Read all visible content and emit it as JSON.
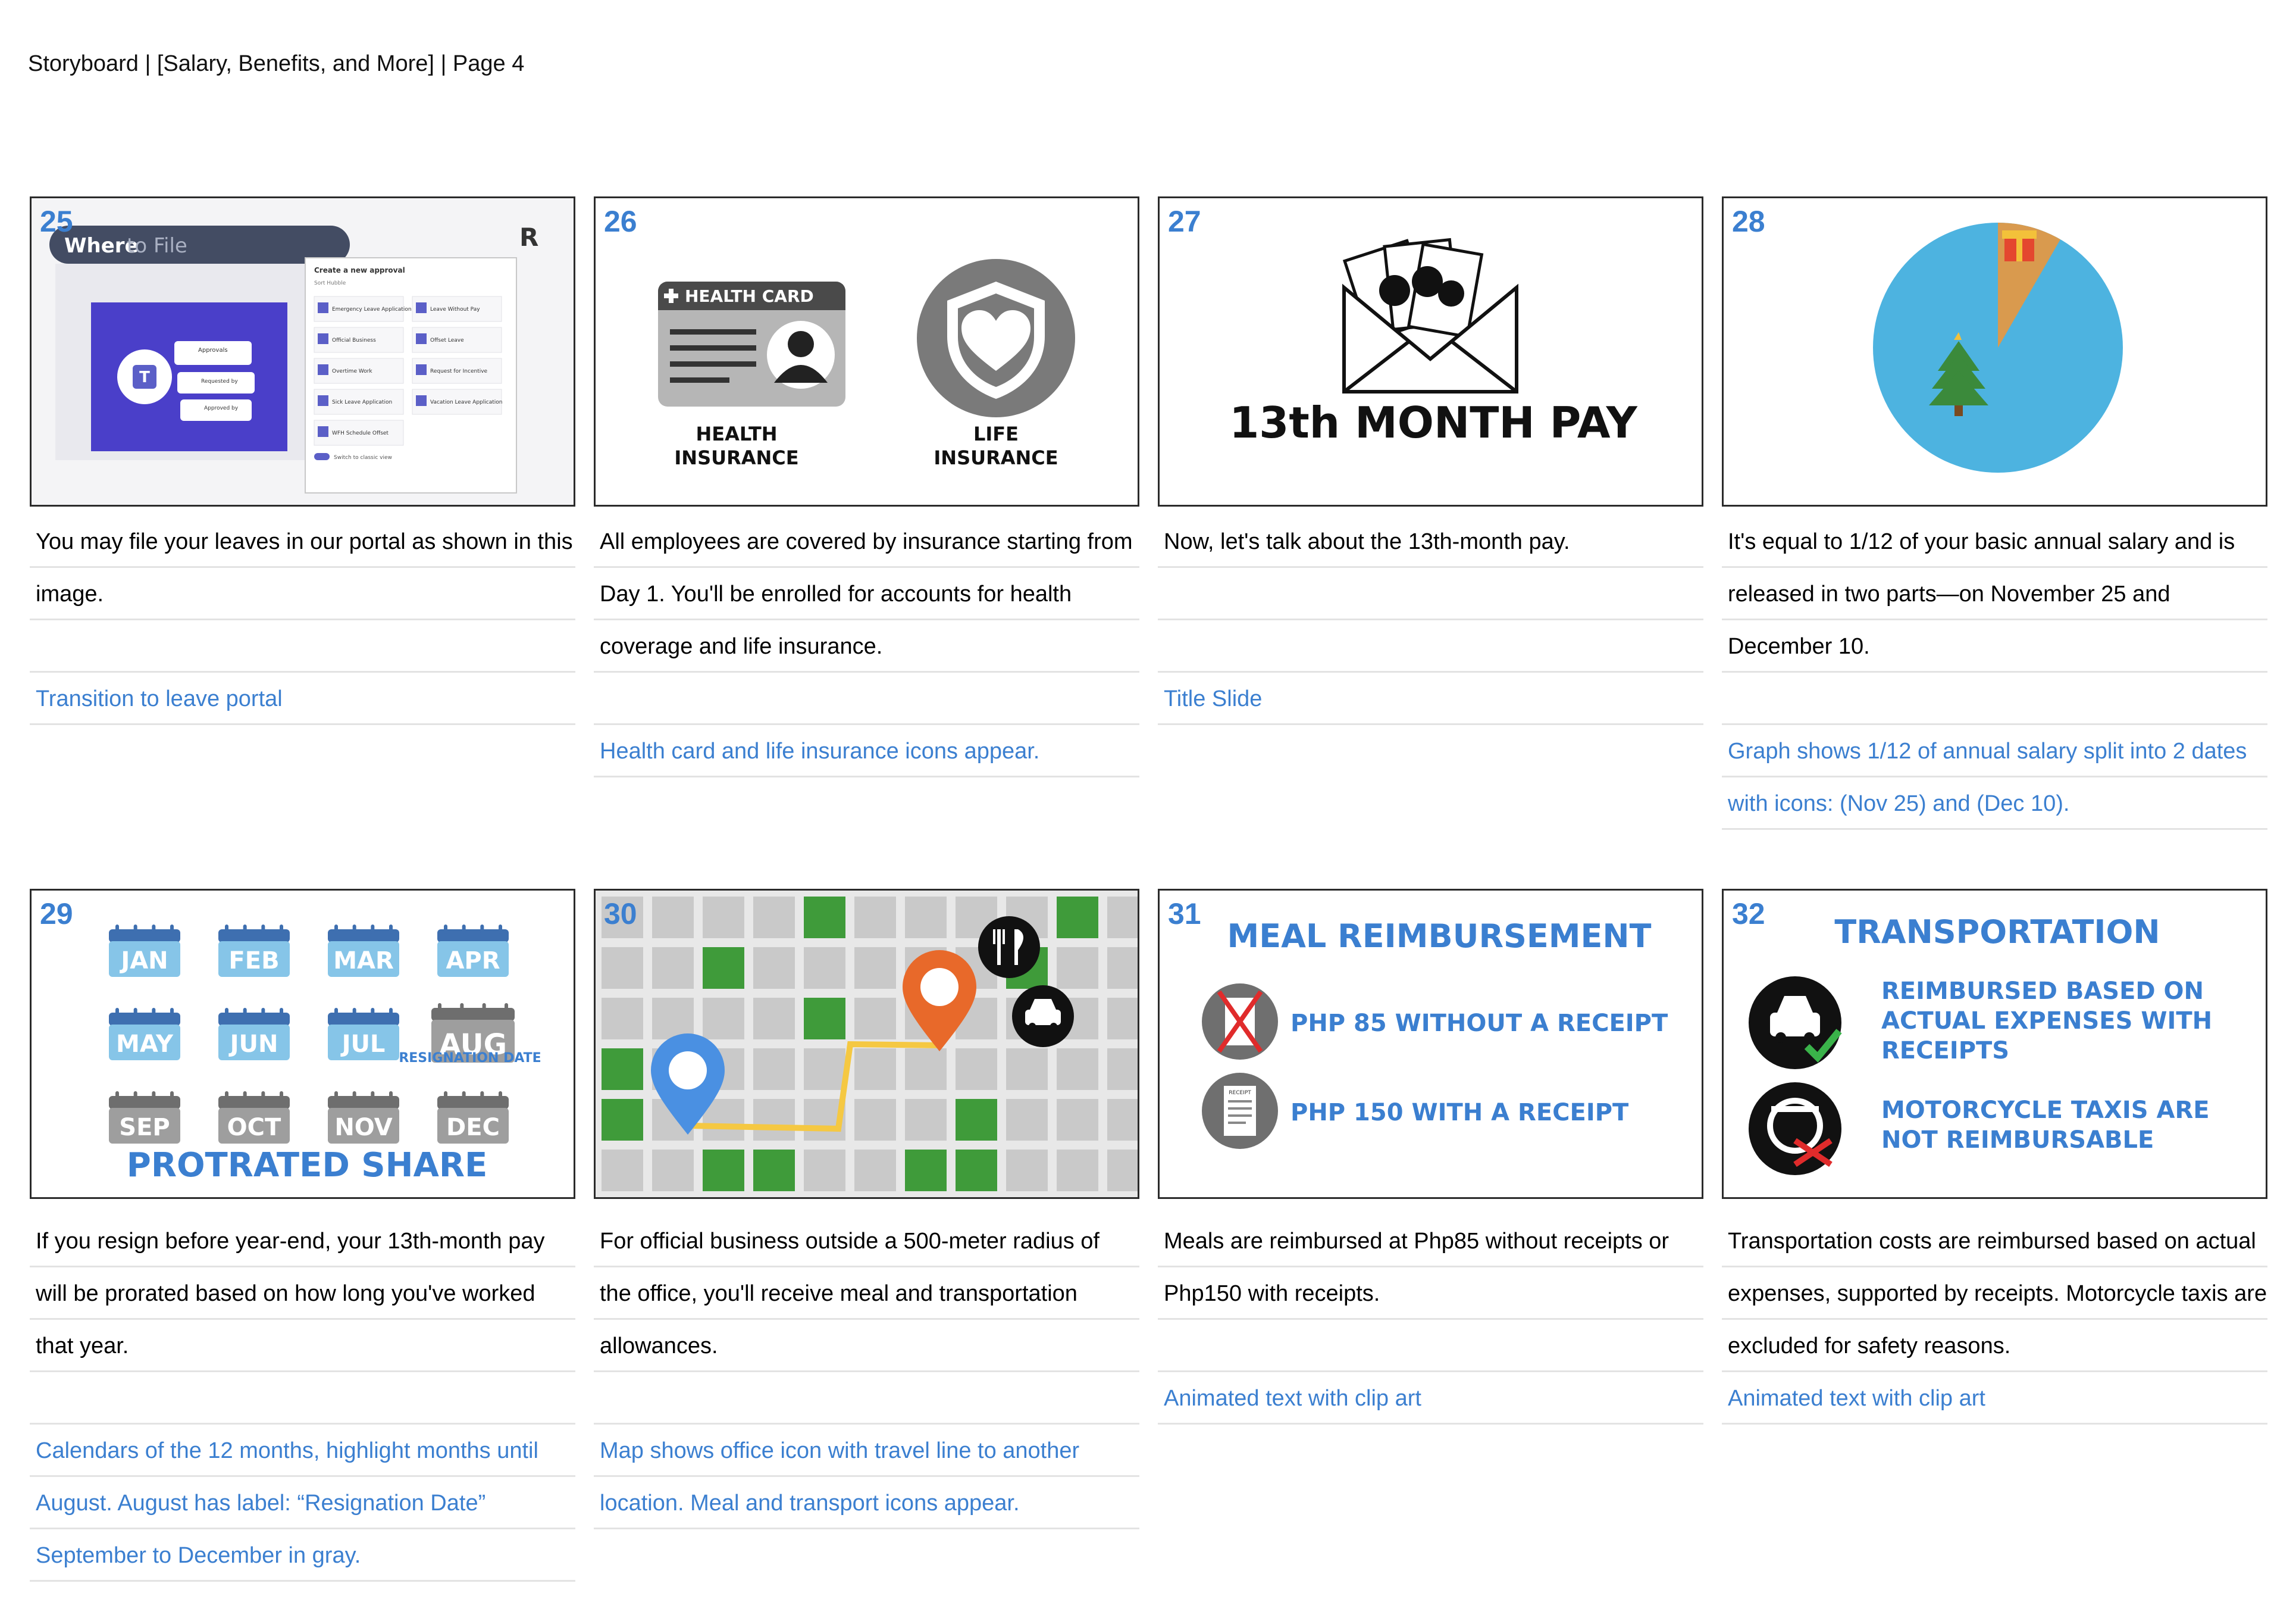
{
  "header": {
    "title": "Storyboard | [Salary, Benefits, and More] | Page 4"
  },
  "colors": {
    "accent": "#3b7fd0",
    "line": "#e3e3e3",
    "frame": "#2b2b2b"
  },
  "frames": [
    {
      "number": "25",
      "portal": {
        "banner_bold": "Where",
        "banner_rest": " to File",
        "logo": "R",
        "dialog_title": "Create a new approval",
        "dialog_sub": "Sort Hubble",
        "items": [
          "Emergency Leave Application",
          "Leave Without Pay",
          "Official Business",
          "Offset Leave",
          "Overtime Work",
          "Request for Incentive",
          "Sick Leave Application",
          "Vacation Leave Application",
          "WFH Schedule Offset"
        ],
        "toggle": "Switch to classic view",
        "teams_rows": [
          "Approvals",
          "Requested by",
          "Approved by"
        ]
      },
      "lines": [
        {
          "text": "You may file your leaves in our portal as shown in this",
          "color": "black"
        },
        {
          "text": "image.",
          "color": "black"
        },
        {
          "text": "",
          "color": "black"
        },
        {
          "text": "Transition to leave portal",
          "color": "blue"
        }
      ]
    },
    {
      "number": "26",
      "card_title": "HEALTH CARD",
      "label_left_1": "HEALTH",
      "label_left_2": "INSURANCE",
      "label_right_1": "LIFE",
      "label_right_2": "INSURANCE",
      "lines": [
        {
          "text": "All employees are covered by insurance starting from",
          "color": "black"
        },
        {
          "text": "Day 1. You'll be enrolled for accounts for health",
          "color": "black"
        },
        {
          "text": "coverage and life insurance.",
          "color": "black"
        },
        {
          "text": "",
          "color": "black"
        },
        {
          "text": "Health card and life insurance icons appear.",
          "color": "blue"
        }
      ]
    },
    {
      "number": "27",
      "title": "13th MONTH PAY",
      "lines": [
        {
          "text": "Now, let's talk about the 13th-month pay.",
          "color": "black"
        },
        {
          "text": "",
          "color": "black"
        },
        {
          "text": "",
          "color": "black"
        },
        {
          "text": "Title Slide",
          "color": "blue"
        }
      ]
    },
    {
      "number": "28",
      "pie": {
        "slice_fraction": 0.0833,
        "main_color": "#4db3e0",
        "slice_color": "#d99a4e"
      },
      "lines": [
        {
          "text": "It's equal to 1/12 of your basic annual salary and is",
          "color": "black"
        },
        {
          "text": "released in two parts—on November 25 and",
          "color": "black"
        },
        {
          "text": "December 10.",
          "color": "black"
        },
        {
          "text": "",
          "color": "black"
        },
        {
          "text": "Graph shows 1/12 of annual salary split into 2 dates",
          "color": "blue"
        },
        {
          "text": "with icons: (Nov 25) and (Dec 10).",
          "color": "blue"
        }
      ]
    },
    {
      "number": "29",
      "months": [
        "JAN",
        "FEB",
        "MAR",
        "APR",
        "MAY",
        "JUN",
        "JUL",
        "AUG",
        "SEP",
        "OCT",
        "NOV",
        "DEC"
      ],
      "resignation": "RESIGNATION DATE",
      "title": "PROTRATED SHARE",
      "lines": [
        {
          "text": "If you resign before year-end, your 13th-month pay",
          "color": "black"
        },
        {
          "text": "will be prorated based on how long you've worked",
          "color": "black"
        },
        {
          "text": "that year.",
          "color": "black"
        },
        {
          "text": "",
          "color": "black"
        },
        {
          "text": "Calendars of the 12 months, highlight months until",
          "color": "blue"
        },
        {
          "text": "August. August has label: “Resignation Date”",
          "color": "blue"
        },
        {
          "text": "September to December in gray.",
          "color": "blue"
        }
      ]
    },
    {
      "number": "30",
      "lines": [
        {
          "text": "For official business outside a 500-meter radius of",
          "color": "black"
        },
        {
          "text": "the office, you'll receive meal and transportation",
          "color": "black"
        },
        {
          "text": "allowances.",
          "color": "black"
        },
        {
          "text": "",
          "color": "black"
        },
        {
          "text": "Map shows office icon with travel line to another",
          "color": "blue"
        },
        {
          "text": "location. Meal and transport icons appear.",
          "color": "blue"
        }
      ]
    },
    {
      "number": "31",
      "title": "MEAL REIMBURSEMENT",
      "item1": "PHP 85 WITHOUT A RECEIPT",
      "item2": "PHP 150 WITH A RECEIPT",
      "receipt_label": "RECEIPT",
      "lines": [
        {
          "text": "Meals are reimbursed at Php85 without receipts or",
          "color": "black"
        },
        {
          "text": "Php150 with receipts.",
          "color": "black"
        },
        {
          "text": "",
          "color": "black"
        },
        {
          "text": "Animated text with clip art",
          "color": "blue"
        }
      ]
    },
    {
      "number": "32",
      "title": "TRANSPORTATION",
      "item1_l1": "REIMBURSED BASED ON",
      "item1_l2": "ACTUAL EXPENSES WITH",
      "item1_l3": "RECEIPTS",
      "item2_l1": "MOTORCYCLE TAXIS ARE",
      "item2_l2": "NOT REIMBURSABLE",
      "lines": [
        {
          "text": "Transportation costs are reimbursed based on actual",
          "color": "black"
        },
        {
          "text": "expenses, supported by receipts. Motorcycle taxis are",
          "color": "black"
        },
        {
          "text": "excluded for safety reasons.",
          "color": "black"
        },
        {
          "text": "Animated text with clip art",
          "color": "blue"
        }
      ]
    }
  ]
}
